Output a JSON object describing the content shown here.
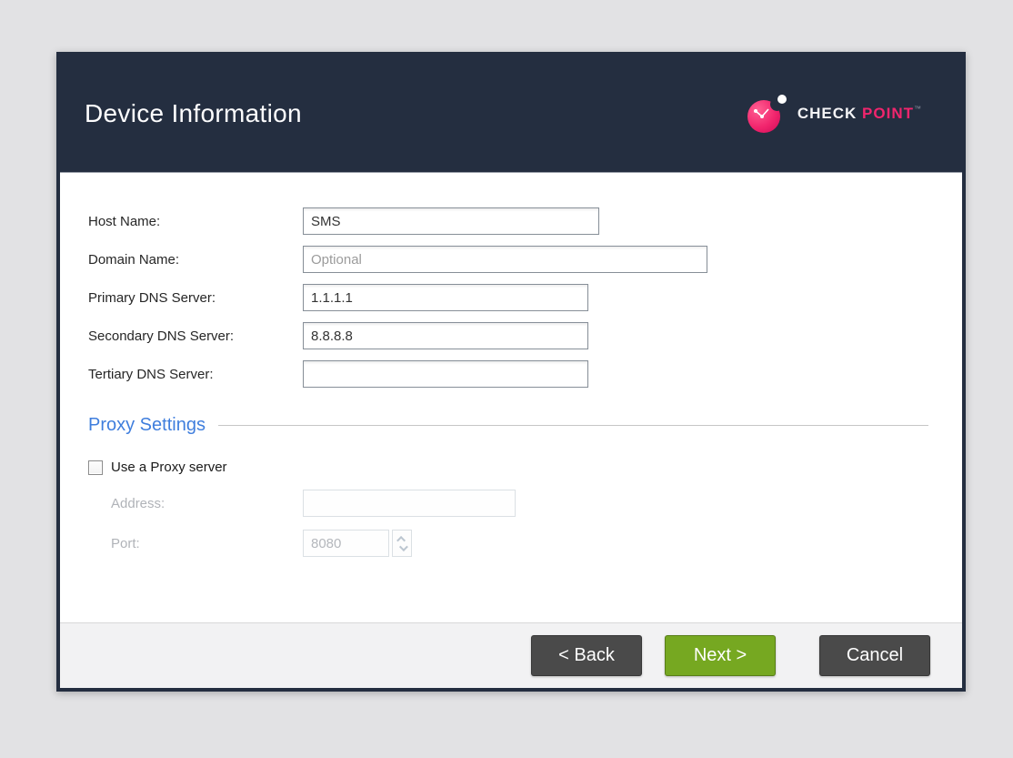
{
  "dialog": {
    "title": "Device Information",
    "logo": {
      "brand_primary": "CHECK",
      "brand_secondary": "POINT",
      "trademark": "™"
    }
  },
  "form": {
    "host_name": {
      "label": "Host Name:",
      "value": "SMS"
    },
    "domain_name": {
      "label": "Domain Name:",
      "value": "",
      "placeholder": "Optional"
    },
    "primary_dns": {
      "label": "Primary DNS Server:",
      "value": "1.1.1.1"
    },
    "secondary_dns": {
      "label": "Secondary DNS Server:",
      "value": "8.8.8.8"
    },
    "tertiary_dns": {
      "label": "Tertiary DNS Server:",
      "value": ""
    }
  },
  "proxy": {
    "section_title": "Proxy Settings",
    "checkbox_label": "Use a Proxy server",
    "checkbox_checked": false,
    "address": {
      "label": "Address:",
      "value": ""
    },
    "port": {
      "label": "Port:",
      "value": "8080"
    }
  },
  "footer": {
    "back_label": "< Back",
    "next_label": "Next >",
    "cancel_label": "Cancel"
  },
  "colors": {
    "header_navy": "#242e40",
    "accent_green": "#76a821",
    "brand_pink": "#f1256d",
    "section_blue": "#3f7edd",
    "button_gray": "#4a4a4a",
    "page_background": "#e2e2e4"
  }
}
